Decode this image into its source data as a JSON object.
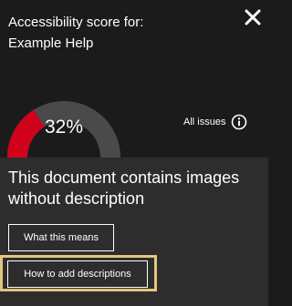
{
  "panel": {
    "title_line1": "Accessibility score for:",
    "title_line2": "Example Help",
    "close_icon": "close-icon"
  },
  "score": {
    "value": 32,
    "label": "32%",
    "fill_color": "#d0021b",
    "track_color": "#4a4a4a"
  },
  "all_issues": {
    "label": "All issues",
    "icon": "info-icon"
  },
  "message": {
    "text": "This document contains images without description"
  },
  "buttons": {
    "what_this_means": "What this means",
    "how_to_add": "How to add descriptions"
  },
  "colors": {
    "background_top": "#1b1b1b",
    "background_bottom": "#2d2d2d",
    "focus_ring": "#e3c67e"
  }
}
